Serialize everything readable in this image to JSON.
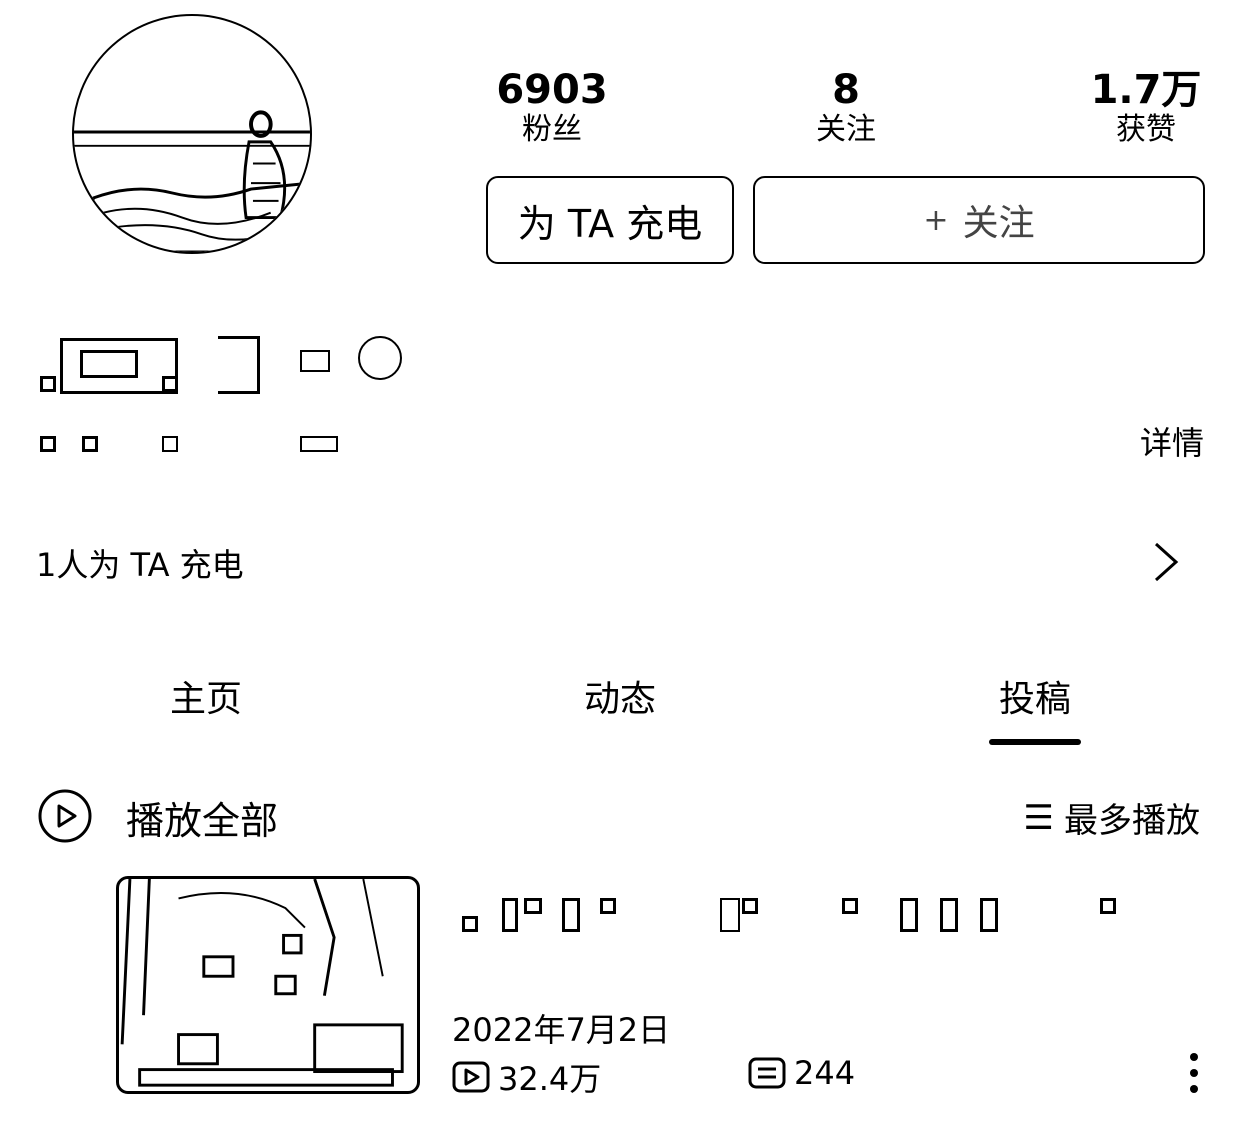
{
  "profile": {
    "stats": [
      {
        "value": "6903",
        "label": "粉丝"
      },
      {
        "value": "8",
        "label": "关注"
      },
      {
        "value": "1.7万",
        "label": "获赞"
      }
    ],
    "charge_button": "为 TA 充电",
    "follow_button": "关注",
    "follow_icon": "plus-icon",
    "detail_link": "详情",
    "charge_row": "1人为 TA 充电"
  },
  "tabs": [
    {
      "label": "主页",
      "active": false
    },
    {
      "label": "动态",
      "active": false
    },
    {
      "label": "投稿",
      "active": true
    }
  ],
  "list_header": {
    "play_all": "播放全部",
    "sort": "最多播放",
    "sort_icon": "menu-lines-icon"
  },
  "video": {
    "date": "2022年7月2日",
    "plays": "32.4万",
    "comments": "244"
  }
}
